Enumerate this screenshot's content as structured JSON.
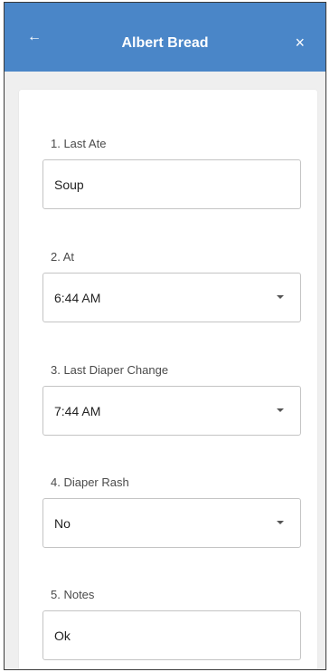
{
  "header": {
    "back_icon": "←",
    "title": "Albert Bread",
    "close_icon": "×",
    "bg_color": "#4a86c8"
  },
  "form": {
    "last_ate": {
      "label": "1. Last Ate",
      "value": "Soup"
    },
    "at": {
      "label": "2. At",
      "value": "6:44 AM"
    },
    "last_diaper_change": {
      "label": "3. Last Diaper Change",
      "value": "7:44 AM"
    },
    "diaper_rash": {
      "label": "4. Diaper Rash",
      "value": "No"
    },
    "notes": {
      "label": "5. Notes",
      "value": "Ok"
    }
  }
}
